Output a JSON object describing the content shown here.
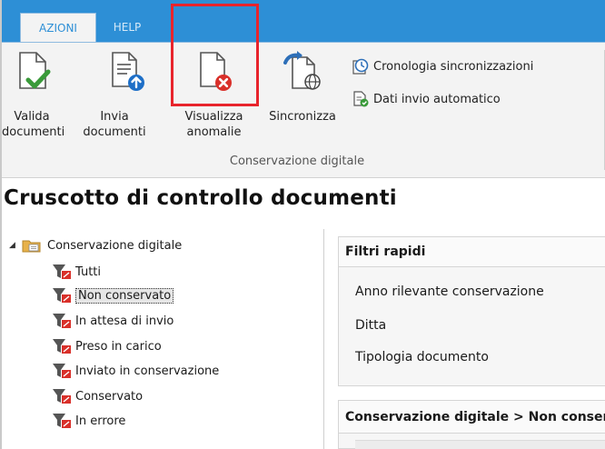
{
  "ribbon": {
    "tabs": [
      {
        "label": "AZIONI",
        "active": true
      },
      {
        "label": "HELP",
        "active": false
      }
    ],
    "buttons": {
      "valida": {
        "line1": "Valida",
        "line2": "documenti"
      },
      "invia": {
        "line1": "Invia",
        "line2": "documenti"
      },
      "visualizza": {
        "line1": "Visualizza",
        "line2": "anomalie"
      },
      "sincronizza": {
        "line1": "Sincronizza"
      }
    },
    "small_buttons": {
      "cronologia": "Cronologia sincronizzazioni",
      "dati_invio": "Dati invio automatico"
    },
    "group_label": "Conservazione digitale"
  },
  "page": {
    "title": "Cruscotto di controllo documenti"
  },
  "tree": {
    "root": "Conservazione digitale",
    "items": [
      {
        "label": "Tutti",
        "selected": false
      },
      {
        "label": "Non conservato",
        "selected": true
      },
      {
        "label": "In attesa di invio",
        "selected": false
      },
      {
        "label": "Preso in carico",
        "selected": false
      },
      {
        "label": "Inviato in conservazione",
        "selected": false
      },
      {
        "label": "Conservato",
        "selected": false
      },
      {
        "label": "In errore",
        "selected": false
      }
    ]
  },
  "filters": {
    "header": "Filtri rapidi",
    "rows": [
      "Anno rilevante conservazione",
      "Ditta",
      "Tipologia documento"
    ]
  },
  "details": {
    "header": "Conservazione digitale > Non conservato"
  },
  "colors": {
    "accent": "#2d8fd6",
    "highlight": "#e8242c",
    "check_green": "#3a9a3a",
    "error_red": "#d9302a"
  }
}
